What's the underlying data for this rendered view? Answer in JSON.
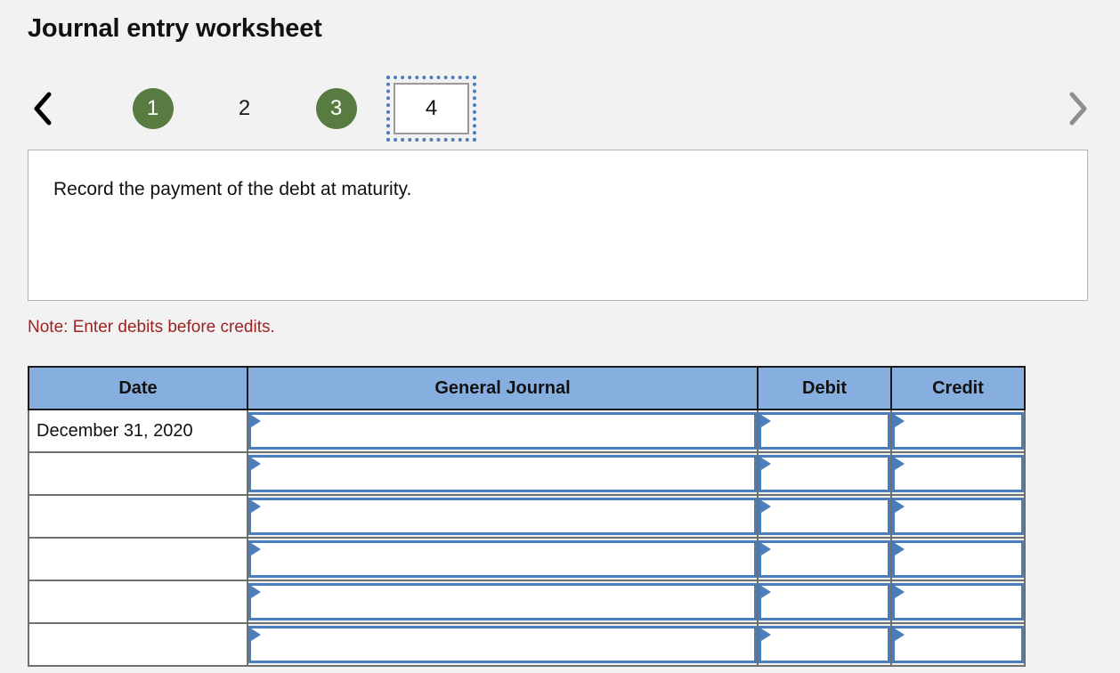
{
  "page": {
    "title": "Journal entry worksheet",
    "background_color": "#f2f2f2"
  },
  "pager": {
    "prev_icon": "chevron-left-icon",
    "next_icon": "chevron-right-icon",
    "prev_enabled_color": "#000000",
    "next_enabled_color": "#8e8e8e",
    "completed_color": "#577b41",
    "focus_outline_color": "#4a7ebb",
    "steps": [
      {
        "label": "1",
        "state": "completed"
      },
      {
        "label": "2",
        "state": "available"
      },
      {
        "label": "3",
        "state": "completed"
      },
      {
        "label": "4",
        "state": "current"
      }
    ]
  },
  "instruction": {
    "text": "Record the payment of the debt at maturity."
  },
  "note": {
    "text": "Note: Enter debits before credits.",
    "color": "#9c2222"
  },
  "journal": {
    "header_color": "#86afe0",
    "field_border_color": "#4a7ebb",
    "columns": [
      "Date",
      "General Journal",
      "Debit",
      "Credit"
    ],
    "rows": [
      {
        "date": "December 31, 2020",
        "general_journal": "",
        "debit": "",
        "credit": ""
      },
      {
        "date": "",
        "general_journal": "",
        "debit": "",
        "credit": ""
      },
      {
        "date": "",
        "general_journal": "",
        "debit": "",
        "credit": ""
      },
      {
        "date": "",
        "general_journal": "",
        "debit": "",
        "credit": ""
      },
      {
        "date": "",
        "general_journal": "",
        "debit": "",
        "credit": ""
      },
      {
        "date": "",
        "general_journal": "",
        "debit": "",
        "credit": ""
      }
    ]
  }
}
